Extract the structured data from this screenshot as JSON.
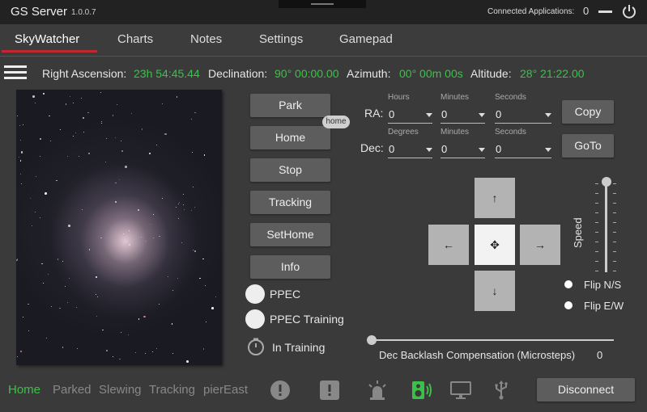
{
  "app": {
    "title": "GS Server",
    "version": "1.0.0.7",
    "connected_label": "Connected Applications:",
    "connected_count": "0"
  },
  "tabs": [
    {
      "label": "SkyWatcher",
      "active": true
    },
    {
      "label": "Charts"
    },
    {
      "label": "Notes"
    },
    {
      "label": "Settings"
    },
    {
      "label": "Gamepad"
    }
  ],
  "coords": {
    "ra_label": "Right Ascension:",
    "ra_value": "23h 54:45.44",
    "dec_label": "Declination:",
    "dec_value": "90° 00:00.00",
    "az_label": "Azimuth:",
    "az_value": "00° 00m 00s",
    "alt_label": "Altitude:",
    "alt_value": "28° 21:22.00"
  },
  "commands": [
    "Park",
    "Home",
    "Stop",
    "Tracking",
    "SetHome",
    "Info"
  ],
  "home_badge": "home",
  "toggles": {
    "ppec": "PPEC",
    "ppec_training": "PPEC Training",
    "in_training": "In Training"
  },
  "goto": {
    "ra_label": "RA:",
    "dec_label": "Dec:",
    "ra": {
      "hours_cap": "Hours",
      "hours": "0",
      "minutes_cap": "Minutes",
      "minutes": "0",
      "seconds_cap": "Seconds",
      "seconds": "0"
    },
    "dec": {
      "degrees_cap": "Degrees",
      "degrees": "0",
      "minutes_cap": "Minutes",
      "minutes": "0",
      "seconds_cap": "Seconds",
      "seconds": "0"
    },
    "copy_label": "Copy",
    "goto_label": "GoTo"
  },
  "pad": {
    "up": "↑",
    "down": "↓",
    "left": "←",
    "right": "→",
    "center": "✥"
  },
  "speed": {
    "label": "Speed",
    "level_fraction": 1.0
  },
  "flip": {
    "ns": "Flip N/S",
    "ew": "Flip E/W"
  },
  "backlash": {
    "label": "Dec Backlash Compensation (Microsteps)",
    "value": "0"
  },
  "status": [
    {
      "label": "Home",
      "active": true
    },
    {
      "label": "Parked"
    },
    {
      "label": "Slewing"
    },
    {
      "label": "Tracking"
    },
    {
      "label": "pierEast"
    }
  ],
  "disconnect_label": "Disconnect",
  "colors": {
    "accent_green": "#3bc14a",
    "tab_underline": "#c0282d"
  }
}
